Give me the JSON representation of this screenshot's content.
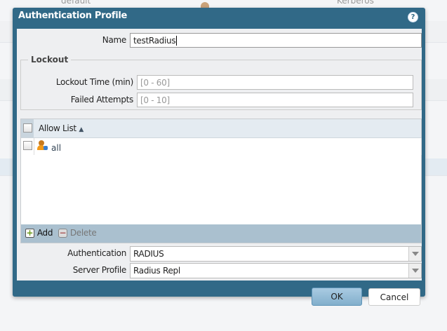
{
  "background": {
    "cells": [
      "default",
      "Kerberos"
    ]
  },
  "dialog": {
    "title": "Authentication Profile",
    "help_icon": "question-circle-icon",
    "name": {
      "label": "Name",
      "value": "testRadius"
    },
    "lockout": {
      "legend": "Lockout",
      "lockout_time": {
        "label": "Lockout Time (min)",
        "placeholder": "[0 - 60]"
      },
      "failed_attempts": {
        "label": "Failed Attempts",
        "placeholder": "[0 - 10]"
      }
    },
    "allow_list": {
      "header": "Allow List",
      "sort": "ascending",
      "rows": [
        {
          "label": "all",
          "icon": "user-group-icon",
          "checked": false
        }
      ],
      "add_label": "Add",
      "delete_label": "Delete"
    },
    "authentication": {
      "label": "Authentication",
      "value": "RADIUS"
    },
    "server_profile": {
      "label": "Server Profile",
      "value": "Radius Repl"
    },
    "ok_label": "OK",
    "cancel_label": "Cancel"
  },
  "colors": {
    "titlebar": "#316987",
    "grid_footer": "#aac0cf",
    "ok_button": "#8fb8d3"
  }
}
